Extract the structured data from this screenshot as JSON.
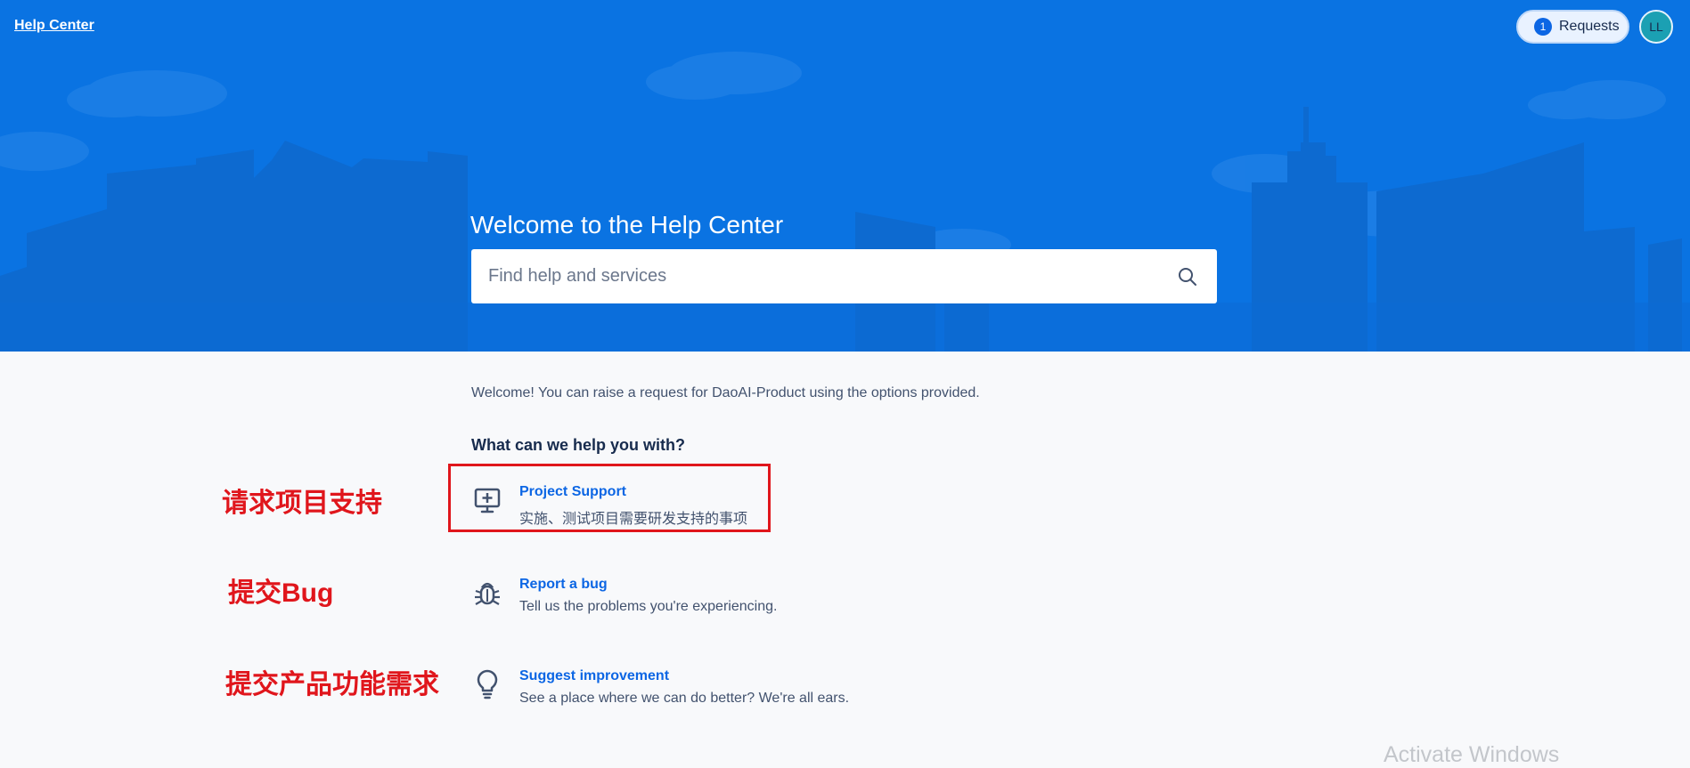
{
  "header": {
    "help_center_link": "Help Center",
    "requests_label": "Requests",
    "requests_count": "1",
    "avatar_initials": "LL"
  },
  "hero": {
    "title": "Welcome to the Help Center",
    "search_placeholder": "Find help and services",
    "search_value": ""
  },
  "main": {
    "intro": "Welcome! You can raise a request for DaoAI-Product using the options provided.",
    "heading": "What can we help you with?",
    "options": [
      {
        "icon": "monitor-plus-icon",
        "title": "Project Support",
        "description": "实施、测试项目需要研发支持的事项"
      },
      {
        "icon": "bug-icon",
        "title": "Report a bug",
        "description": "Tell us the problems you're experiencing."
      },
      {
        "icon": "lightbulb-icon",
        "title": "Suggest improvement",
        "description": "See a place where we can do better? We're all ears."
      }
    ]
  },
  "annotations": {
    "project_support": "请求项目支持",
    "bug": "提交Bug",
    "feature": "提交产品功能需求"
  },
  "watermark": "Activate Windows",
  "colors": {
    "hero_background": "#0a73e2",
    "link": "#0c66e4",
    "annotation_red": "#e0161c"
  }
}
